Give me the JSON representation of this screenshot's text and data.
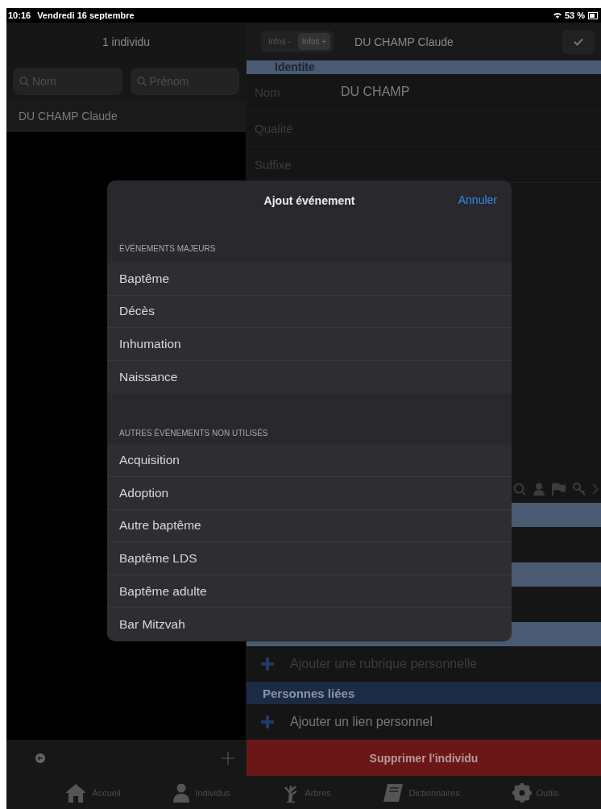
{
  "status_bar": {
    "time": "10:16",
    "date": "Vendredi 16 septembre",
    "battery": "53 %"
  },
  "left_pane": {
    "title": "1 individu",
    "search_fields": [
      {
        "placeholder": "Nom"
      },
      {
        "placeholder": "Prénom"
      }
    ],
    "list": [
      "DU CHAMP Claude"
    ]
  },
  "right_pane": {
    "segments": [
      {
        "label": "Infos -",
        "selected": false
      },
      {
        "label": "Infos +",
        "selected": true
      }
    ],
    "title": "DU CHAMP Claude",
    "section": "Identite",
    "fields": [
      {
        "label": "Nom",
        "value": "DU CHAMP"
      },
      {
        "label": "Qualité"
      },
      {
        "label": "Suffixe"
      }
    ],
    "add_rubrique": "Ajouter une rubrique personnelle",
    "linked_section": "Personnes liées",
    "add_link": "Ajouter un lien personnel",
    "delete_button": "Supprimer l'individu"
  },
  "tab_bar": [
    {
      "label": "Accueil",
      "kind": "home"
    },
    {
      "label": "Individus",
      "kind": "person"
    },
    {
      "label": "Arbres",
      "kind": "tree"
    },
    {
      "label": "Dictionnaires",
      "kind": "book"
    },
    {
      "label": "Outils",
      "kind": "gear"
    }
  ],
  "modal": {
    "title": "Ajout événement",
    "cancel": "Annuler",
    "sections": [
      {
        "header": "ÉVÉNEMENTS MAJEURS",
        "items": [
          "Baptême",
          "Décès",
          "Inhumation",
          "Naissance"
        ]
      },
      {
        "header": "AUTRES ÉVÉNEMENTS NON UTILISÉS",
        "items": [
          "Acquisition",
          "Adoption",
          "Autre baptême",
          "Baptême LDS",
          "Baptême adulte",
          "Bar Mitzvah"
        ]
      }
    ]
  }
}
